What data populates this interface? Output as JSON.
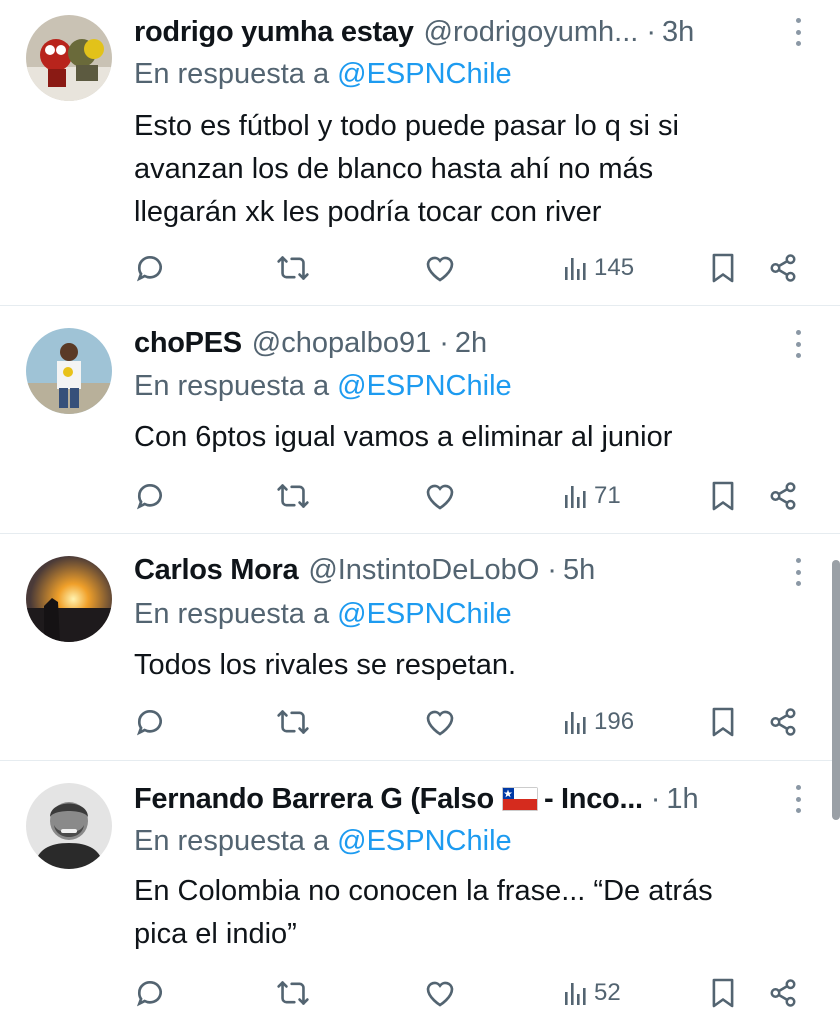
{
  "tweets": [
    {
      "name": "rodrigo yumha estay",
      "handle": "@rodrigoyumh...",
      "time": "3h",
      "reply_prefix": "En respuesta a",
      "reply_mention": "@ESPNChile",
      "text_lines": [
        "Esto es fútbol y todo puede pasar lo q si si",
        "avanzan los de blanco hasta ahí no más",
        "llegarán xk les podría tocar con river"
      ],
      "views": "145"
    },
    {
      "name": "choPES",
      "handle": "@chopalbo91",
      "time": "2h",
      "reply_prefix": "En respuesta a",
      "reply_mention": "@ESPNChile",
      "text_lines": [
        "Con 6ptos igual vamos a eliminar al junior"
      ],
      "views": "71"
    },
    {
      "name": "Carlos Mora",
      "handle": "@InstintoDeLobO",
      "time": "5h",
      "reply_prefix": "En respuesta a",
      "reply_mention": "@ESPNChile",
      "text_lines": [
        "Todos los rivales se respetan."
      ],
      "views": "196"
    },
    {
      "name": "Fernando Barrera G (Falso",
      "name_suffix": "- Inco...",
      "flag": "chile-flag-emoji",
      "handle": "",
      "time": "1h",
      "reply_prefix": "En respuesta a",
      "reply_mention": "@ESPNChile",
      "text_lines": [
        "En Colombia no conocen la frase... “De atrás",
        "pica el indio”"
      ],
      "views": "52"
    }
  ],
  "time_separator": "·",
  "icons": [
    "reply-icon",
    "retweet-icon",
    "like-icon",
    "views-icon",
    "bookmark-icon",
    "share-icon",
    "more-icon"
  ],
  "colors": {
    "text": "#0f1419",
    "secondary": "#536471",
    "mention": "#1d9bf0",
    "divider": "#e6ecf0"
  }
}
